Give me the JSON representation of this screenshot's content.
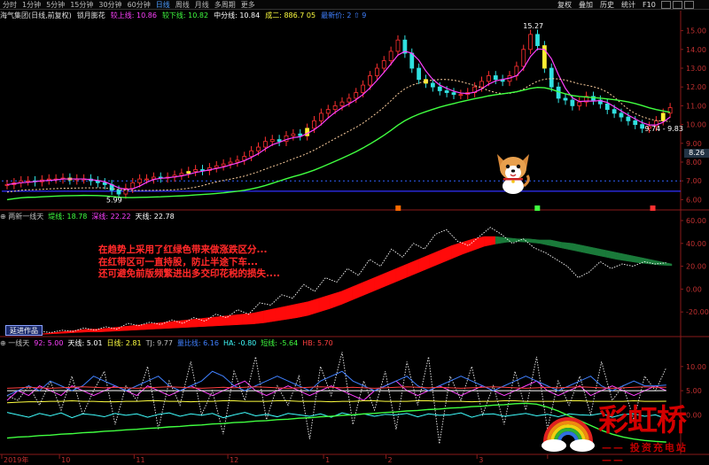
{
  "tabs": [
    "分时",
    "1分钟",
    "5分钟",
    "15分钟",
    "30分钟",
    "60分钟",
    "日线",
    "周线",
    "月线",
    "多周期",
    "更多"
  ],
  "active_tab": 6,
  "right_menu": [
    "复权",
    "叠加",
    "历史",
    "统计",
    "F10"
  ],
  "main_legend": [
    {
      "text": "海气集团(日线,前复权)",
      "color": "#e0e0e0"
    },
    {
      "text": "锁月膨花",
      "color": "#e0e0e0"
    },
    {
      "text": "较上线: 10.86",
      "color": "#ff40ff"
    },
    {
      "text": "较下线: 10.82",
      "color": "#40ff40"
    },
    {
      "text": "中分线: 10.84",
      "color": "#ffffff"
    },
    {
      "text": "成二: 886.7 05",
      "color": "#ffff40"
    },
    {
      "text": "最新价: 2 ⇧ 9",
      "color": "#4080ff"
    }
  ],
  "mid_legend": [
    {
      "text": "⊕ 两新一线天",
      "color": "#c0c0c0"
    },
    {
      "text": "堤线: 18.78",
      "color": "#40ff40"
    },
    {
      "text": "深线: 22.22",
      "color": "#ff40ff"
    },
    {
      "text": "天线: 22.78",
      "color": "#ffffff"
    }
  ],
  "low_legend": [
    {
      "text": "⊕ 一线天",
      "color": "#c0c0c0"
    },
    {
      "text": "92: 5.00",
      "color": "#ff40ff"
    },
    {
      "text": "天线: 5.01",
      "color": "#ffffff"
    },
    {
      "text": "日线: 2.81",
      "color": "#ffff40"
    },
    {
      "text": "TJ: 9.77",
      "color": "#c0c0c0"
    },
    {
      "text": "量比线: 6.16",
      "color": "#4080ff"
    },
    {
      "text": "HA: -0.80",
      "color": "#40ffff"
    },
    {
      "text": "短线: -5.64",
      "color": "#40ff40"
    },
    {
      "text": "HB: 5.70",
      "color": "#ff4040"
    }
  ],
  "annotation_lines": [
    "在趋势上采用了红绿色带来做涨跌区分...",
    "在红带区可一直持股，防止半途下车...",
    "还可避免前版频繁进出多交印花税的损失...."
  ],
  "buttons": {
    "mid_button": "延进作品",
    "low_button": ""
  },
  "watermark": {
    "title": "彩虹桥",
    "subtitle": "—— 投资充电站 ——"
  },
  "x_axis_labels": [
    {
      "text": "2019年",
      "pos": 0.0
    },
    {
      "text": "10",
      "pos": 0.085
    },
    {
      "text": "11",
      "pos": 0.195
    },
    {
      "text": "12",
      "pos": 0.333
    },
    {
      "text": "1",
      "pos": 0.474
    },
    {
      "text": "2",
      "pos": 0.566
    },
    {
      "text": "3",
      "pos": 0.7
    },
    {
      "text": "",
      "pos": 0.804
    }
  ],
  "chart_data": [
    {
      "type": "candlestick",
      "title": "海气集团(日线,前复权)",
      "ylim": [
        5.5,
        15.5
      ],
      "y_ticks": [
        6.0,
        7.0,
        8.0,
        9.0,
        10.0,
        11.0,
        12.0,
        13.0,
        14.0,
        15.0
      ],
      "annotations": [
        {
          "text": "15.27",
          "x": 0.781,
          "y": 15.27
        },
        {
          "text": "5.99",
          "x": 0.167,
          "y": 5.99
        },
        {
          "text": "9.74 - 9.83",
          "x": 0.96,
          "y": 9.8
        },
        {
          "text": "8.26",
          "x": 1.0,
          "y": 8.26
        }
      ],
      "price_points": [
        6.8,
        6.9,
        7.0,
        7.0,
        6.95,
        7.05,
        7.1,
        7.1,
        7.15,
        7.05,
        7.1,
        7.1,
        7.0,
        6.9,
        6.8,
        6.5,
        6.3,
        6.6,
        6.9,
        7.1,
        7.1,
        7.2,
        7.15,
        7.2,
        7.3,
        7.4,
        7.5,
        7.6,
        7.55,
        7.7,
        7.8,
        7.9,
        8.0,
        8.1,
        8.3,
        8.6,
        8.8,
        9.1,
        9.2,
        9.1,
        9.4,
        9.5,
        9.4,
        9.8,
        10.2,
        10.6,
        10.8,
        11.0,
        11.2,
        11.4,
        11.7,
        12.1,
        12.6,
        13.0,
        13.4,
        13.9,
        14.5,
        13.8,
        13.0,
        12.4,
        12.2,
        12.0,
        11.8,
        11.7,
        11.6,
        11.6,
        11.7,
        12.0,
        12.3,
        12.6,
        12.4,
        12.3,
        12.6,
        13.1,
        14.0,
        14.8,
        14.2,
        13.0,
        12.0,
        11.4,
        11.3,
        11.0,
        11.2,
        11.5,
        11.3,
        11.1,
        10.8,
        10.6,
        10.4,
        10.2,
        10.0,
        9.8,
        9.9,
        10.2,
        10.6,
        10.9
      ]
    },
    {
      "type": "area",
      "title": "两新一线天",
      "ylim": [
        -40,
        60
      ],
      "y_ticks": [
        60.0,
        40.0,
        20.0,
        0.0,
        -20.0
      ],
      "band_upper": [
        -40.0,
        -40.0,
        -39.0,
        -39.0,
        -38.0,
        -37.0,
        -36.0,
        -35.0,
        -35.0,
        -34.0,
        -33.0,
        -32.0,
        -31.0,
        -30.0,
        -29.0,
        -28.0,
        -27.0,
        -26.0,
        -25.0,
        -24.0,
        -23.0,
        -22.0,
        -21.0,
        -19.0,
        -17.0,
        -15.0,
        -13.0,
        -11.0,
        -8.0,
        -5.0,
        -2.0,
        2.0,
        6.0,
        10.0,
        14.0,
        18.0,
        22.0,
        26.0,
        30.0,
        34.0,
        38.0,
        41.0,
        44.0,
        46.0,
        46.0,
        45.0,
        44.0,
        44.0,
        43.0,
        43.0,
        41.0,
        40.0,
        38.0,
        36.0,
        34.0,
        32.0,
        30.0,
        28.0,
        26.0,
        24.0,
        22.0
      ],
      "band_lower": [
        -40.0,
        -40.0,
        -39.5,
        -39.5,
        -39.0,
        -38.5,
        -38.0,
        -37.5,
        -37.5,
        -37.0,
        -36.5,
        -36.0,
        -35.5,
        -35.0,
        -34.5,
        -34.0,
        -33.5,
        -33.0,
        -32.5,
        -32.0,
        -31.5,
        -31.0,
        -30.5,
        -29.5,
        -28.0,
        -26.5,
        -25.0,
        -23.0,
        -20.0,
        -17.0,
        -13.5,
        -9.5,
        -5.5,
        -1.5,
        2.5,
        6.5,
        10.5,
        14.5,
        18.5,
        22.5,
        26.5,
        30.5,
        34.0,
        37.5,
        39.5,
        41.0,
        41.5,
        41.0,
        40.0,
        38.0,
        36.0,
        34.0,
        32.0,
        30.0,
        28.0,
        26.0,
        24.5,
        23.0,
        22.0,
        21.0,
        20.5
      ],
      "dotted": [
        -39,
        -38,
        -40,
        -37,
        -38,
        -36,
        -37,
        -34,
        -36,
        -33,
        -35,
        -30,
        -32,
        -29,
        -31,
        -27,
        -30,
        -25,
        -28,
        -22,
        -25,
        -18,
        -22,
        -12,
        -14,
        -5,
        -8,
        4,
        -2,
        10,
        6,
        18,
        12,
        26,
        20,
        35,
        28,
        40,
        35,
        48,
        52,
        42,
        38,
        46,
        54,
        48,
        40,
        44,
        36,
        32,
        26,
        20,
        10,
        15,
        24,
        18,
        22,
        20,
        24,
        22,
        23
      ]
    },
    {
      "type": "line",
      "title": "一线天",
      "ylim": [
        -8,
        14
      ],
      "y_ticks": [
        10.0,
        5.0,
        0.0
      ],
      "series": [
        {
          "name": "92",
          "values": [
            3,
            5,
            4,
            6,
            5,
            4,
            6,
            5,
            4,
            5,
            6,
            5,
            4,
            6,
            5,
            4,
            5,
            6,
            5,
            4,
            5,
            6,
            7,
            5,
            4,
            5,
            6,
            5,
            4,
            5,
            6,
            5,
            4,
            3,
            5,
            6,
            7,
            5,
            4,
            5,
            6,
            5,
            4,
            5,
            6,
            5,
            4,
            5,
            6,
            7,
            5,
            4,
            5,
            6,
            4,
            5,
            6,
            5,
            4,
            5,
            6,
            5
          ]
        },
        {
          "name": "天线",
          "values": [
            5.0,
            5.0,
            5.01,
            5.0,
            5.0,
            5.01,
            5.0,
            5.0,
            5.0,
            5.0,
            5.01,
            5.0,
            5.0,
            5.0,
            5.01,
            5.0,
            5.0,
            5.0,
            5.0,
            5.01,
            5.0,
            5.0,
            5.0,
            5.0,
            5.0,
            5.0,
            5.01,
            5.0,
            5.0,
            5.0,
            5.0,
            5.0,
            5.0,
            5.0,
            5.01,
            5.0,
            5.0,
            5.0,
            5.0,
            5.0,
            5.0,
            5.0,
            5.01,
            5.0,
            5.0,
            5.0,
            5.0,
            5.0,
            5.0,
            5.0,
            5.0,
            5.0,
            5.01,
            5.0,
            5.0,
            5.0,
            5.0,
            5.0,
            5.0,
            5.0,
            5.0,
            5.01
          ]
        },
        {
          "name": "日线",
          "values": [
            2.5,
            2.6,
            2.7,
            2.7,
            2.8,
            2.8,
            2.9,
            2.8,
            2.8,
            2.7,
            2.7,
            2.8,
            2.8,
            2.9,
            2.9,
            2.8,
            2.8,
            2.7,
            2.8,
            2.8,
            2.9,
            2.9,
            2.8,
            2.8,
            2.8,
            2.9,
            2.9,
            2.8,
            2.8,
            2.8,
            2.7,
            2.8,
            2.8,
            2.9,
            2.9,
            2.8,
            2.8,
            2.8,
            2.9,
            2.9,
            2.8,
            2.8,
            2.8,
            2.7,
            2.8,
            2.8,
            2.9,
            2.9,
            2.8,
            2.8,
            2.8,
            2.8,
            2.9,
            2.9,
            2.8,
            2.8,
            2.8,
            2.8,
            2.9,
            2.8,
            2.8,
            2.81
          ]
        },
        {
          "name": "TJ",
          "values": [
            4,
            3,
            6,
            2,
            7,
            1,
            8,
            0,
            5,
            9,
            -2,
            6,
            3,
            10,
            -3,
            7,
            2,
            11,
            0,
            5,
            -4,
            9,
            3,
            12,
            -1,
            6,
            2,
            8,
            -5,
            10,
            4,
            13,
            -2,
            7,
            1,
            9,
            -3,
            11,
            2,
            12,
            -6,
            8,
            3,
            10,
            0,
            6,
            -2,
            9,
            1,
            12,
            -3,
            7,
            2,
            8,
            0,
            11,
            3,
            6,
            -1,
            8,
            5,
            9.77
          ]
        },
        {
          "name": "量比线",
          "values": [
            4,
            5,
            6,
            5,
            7,
            6,
            5,
            6,
            8,
            7,
            6,
            5,
            6,
            7,
            8,
            6,
            5,
            6,
            7,
            9,
            8,
            6,
            5,
            6,
            7,
            8,
            7,
            6,
            5,
            7,
            8,
            9,
            7,
            6,
            5,
            6,
            7,
            8,
            6,
            5,
            6,
            7,
            8,
            7,
            6,
            5,
            6,
            7,
            8,
            7,
            6,
            5,
            6,
            7,
            8,
            6,
            5,
            6,
            7,
            6,
            6,
            6.16
          ]
        },
        {
          "name": "HA",
          "values": [
            0.5,
            0,
            -0.5,
            0.3,
            -0.2,
            0.4,
            -0.6,
            0.2,
            0,
            -0.4,
            0.3,
            -0.1,
            0.2,
            -0.5,
            0.1,
            0.4,
            -0.3,
            0.2,
            -0.1,
            0.3,
            -0.6,
            0,
            0.5,
            -0.2,
            0.1,
            -0.4,
            0.3,
            0,
            -0.3,
            0.2,
            -0.5,
            0.4,
            -0.1,
            0.2,
            -0.3,
            0.1,
            0,
            0.3,
            -0.4,
            0.2,
            -0.1,
            0,
            0.4,
            -0.5,
            0.1,
            0.2,
            -0.3,
            0,
            0.3,
            -0.2,
            0.1,
            -0.4,
            0.2,
            0,
            -0.1,
            0.3,
            -0.5,
            0.1,
            0.2,
            -0.3,
            0,
            -0.8
          ]
        },
        {
          "name": "短线",
          "values": [
            -4.8,
            -4.6,
            -4.5,
            -4.3,
            -4.2,
            -4.0,
            -3.9,
            -3.7,
            -3.6,
            -3.4,
            -3.3,
            -3.1,
            -3.0,
            -2.8,
            -2.7,
            -2.5,
            -2.4,
            -2.2,
            -2.1,
            -1.9,
            -1.8,
            -1.6,
            -1.5,
            -1.3,
            -1.2,
            -1.0,
            -0.9,
            -0.7,
            -0.6,
            -0.4,
            -0.3,
            -0.1,
            0.0,
            0.2,
            0.3,
            0.5,
            0.6,
            0.8,
            0.9,
            1.1,
            1.2,
            1.4,
            1.5,
            1.7,
            1.8,
            2.0,
            2.1,
            2.3,
            2.4,
            2.2,
            1.6,
            0.8,
            -0.2,
            -1.2,
            -2.2,
            -3.2,
            -4.0,
            -4.6,
            -5.0,
            -5.3,
            -5.5,
            -5.64
          ]
        },
        {
          "name": "HB",
          "values": [
            5.5,
            5.6,
            5.7,
            5.6,
            5.5,
            5.6,
            5.7,
            5.8,
            5.7,
            5.6,
            5.7,
            5.6,
            5.5,
            5.6,
            5.7,
            5.8,
            5.7,
            5.6,
            5.5,
            5.6,
            5.7,
            5.6,
            5.7,
            5.8,
            5.7,
            5.6,
            5.5,
            5.6,
            5.7,
            5.8,
            5.7,
            5.6,
            5.7,
            5.6,
            5.5,
            5.6,
            5.7,
            5.8,
            5.7,
            5.6,
            5.7,
            5.6,
            5.5,
            5.6,
            5.7,
            5.8,
            5.7,
            5.6,
            5.5,
            5.6,
            5.7,
            5.6,
            5.7,
            5.8,
            5.7,
            5.6,
            5.5,
            5.6,
            5.7,
            5.8,
            5.7,
            5.7
          ]
        }
      ]
    }
  ]
}
